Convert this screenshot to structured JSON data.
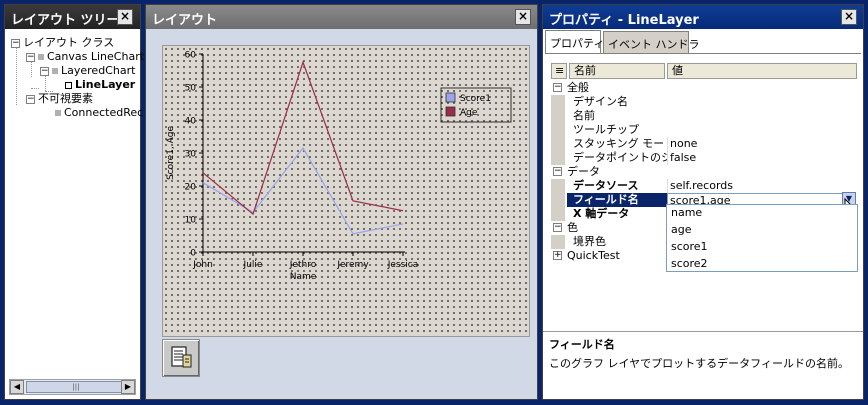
{
  "tree_panel": {
    "title": "レイアウト ツリー",
    "close": "×",
    "nodes": [
      {
        "label": "レイアウト クラス",
        "toggle": "−"
      },
      {
        "label": "Canvas LineChart",
        "toggle": "−"
      },
      {
        "label": "LayeredChart",
        "toggle": "−"
      },
      {
        "label": "LineLayer",
        "selected": true
      },
      {
        "label": "不可視要素",
        "toggle": "−"
      },
      {
        "label": "ConnectedRec"
      }
    ],
    "scroll_left": "◀",
    "scroll_right": "▶",
    "scroll_grip": "|||"
  },
  "layout_panel": {
    "title": "レイアウト",
    "close": "×",
    "tool_icon": "layer-edit-icon"
  },
  "properties_panel": {
    "title": "プロパティ - LineLayer",
    "close": "×",
    "tabs": [
      "プロパティ",
      "イベント ハンドラ"
    ],
    "header_sort": "≡",
    "header_name": "名前",
    "header_value": "値",
    "rows": [
      {
        "type": "category",
        "toggle": "−",
        "label": "全般"
      },
      {
        "type": "prop",
        "label": "デザイン名",
        "value": ""
      },
      {
        "type": "prop",
        "label": "名前",
        "value": ""
      },
      {
        "type": "prop",
        "label": "ツールチップ",
        "value": ""
      },
      {
        "type": "prop",
        "label": "スタッキング モード",
        "value": "none"
      },
      {
        "type": "prop",
        "label": "データポイントのシン",
        "value": "false"
      },
      {
        "type": "category",
        "toggle": "−",
        "label": "データ"
      },
      {
        "type": "prop",
        "label": "データソース",
        "value": "self.records",
        "bold": true
      },
      {
        "type": "prop",
        "label": "フィールド名",
        "value": "score1,age",
        "bold": true,
        "selected": true
      },
      {
        "type": "prop",
        "label": "X 軸データ",
        "value": "",
        "bold": true
      },
      {
        "type": "category",
        "toggle": "−",
        "label": "色"
      },
      {
        "type": "prop",
        "label": "境界色",
        "value": ""
      },
      {
        "type": "category",
        "toggle": "+",
        "label": "QuickTest"
      }
    ],
    "dropdown_arrow": "▼",
    "dropdown_options": [
      "name",
      "age",
      "score1",
      "score2"
    ],
    "description_title": "フィールド名",
    "description_text": "このグラフ レイヤでプロットするデータフィールドの名前。"
  },
  "chart_data": {
    "type": "line",
    "categories": [
      "John",
      "Julie",
      "Jethro",
      "Jeremy",
      "Jessica"
    ],
    "series": [
      {
        "name": "Score1",
        "values": [
          21,
          12,
          31.5,
          5.5,
          8.5
        ],
        "color": "#9aa3ec"
      },
      {
        "name": "Age",
        "values": [
          24,
          11.5,
          57.5,
          15.5,
          12.5
        ],
        "color": "#9b2c4e"
      }
    ],
    "xlabel": "Name",
    "ylabel": "Score1, Age",
    "ylim": [
      0,
      60
    ],
    "yticks": [
      0,
      10,
      20,
      30,
      40,
      50,
      60
    ],
    "legend_position": "right",
    "grid": true
  }
}
